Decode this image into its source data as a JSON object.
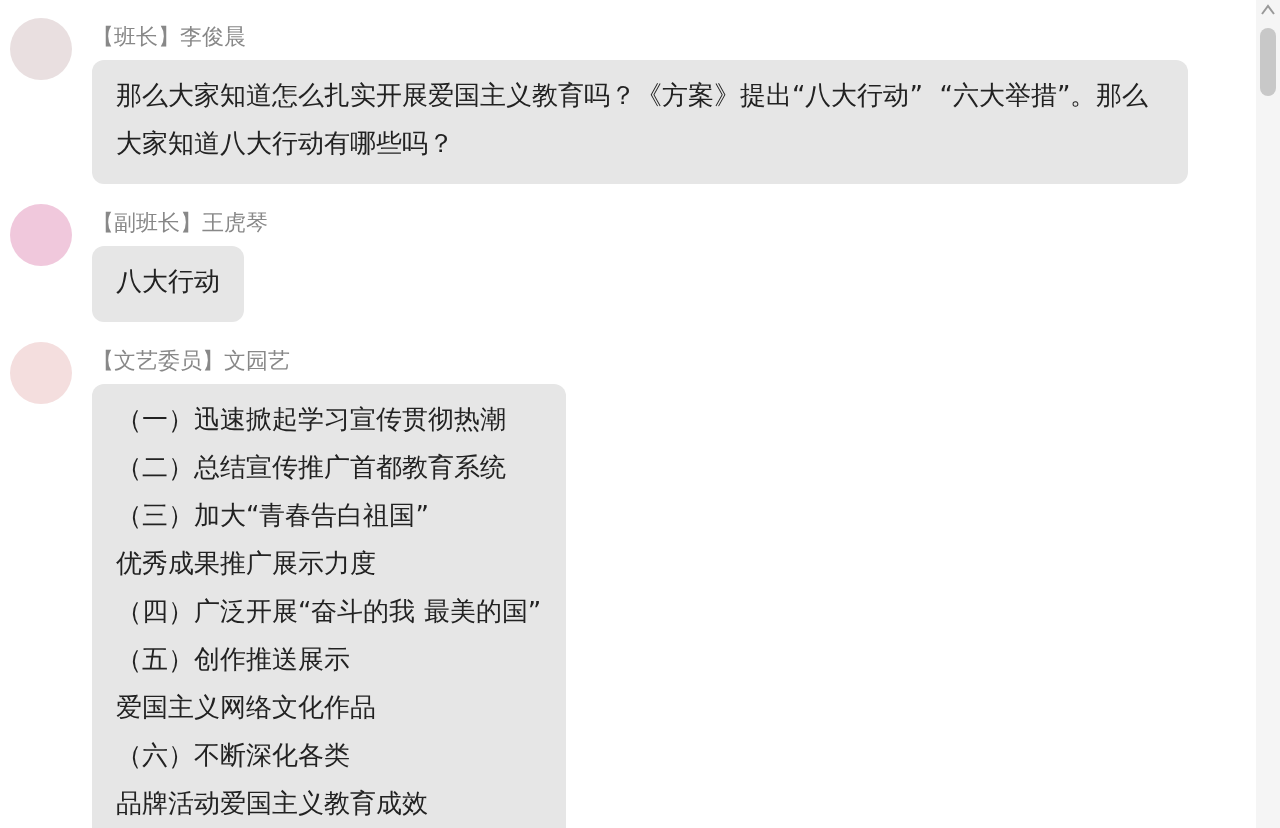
{
  "messages": [
    {
      "role": "【班长】",
      "name": "李俊晨",
      "lines": [
        "那么大家知道怎么扎实开展爱国主义教育吗？《方案》提出“八大行动”  “六大举措”。那么大家知道八大行动有哪些吗？"
      ]
    },
    {
      "role": "【副班长】",
      "name": "王虎琴",
      "lines": [
        "八大行动"
      ]
    },
    {
      "role": "【文艺委员】",
      "name": "文园艺",
      "lines": [
        "（一）迅速掀起学习宣传贯彻热潮",
        "（二）总结宣传推广首都教育系统",
        "（三）加大“青春告白祖国”",
        "优秀成果推广展示力度",
        "（四）广泛开展“奋斗的我 最美的国”",
        "（五）创作推送展示",
        "爱国主义网络文化作品",
        "（六）不断深化各类",
        "品牌活动爱国主义教育成效"
      ]
    }
  ]
}
